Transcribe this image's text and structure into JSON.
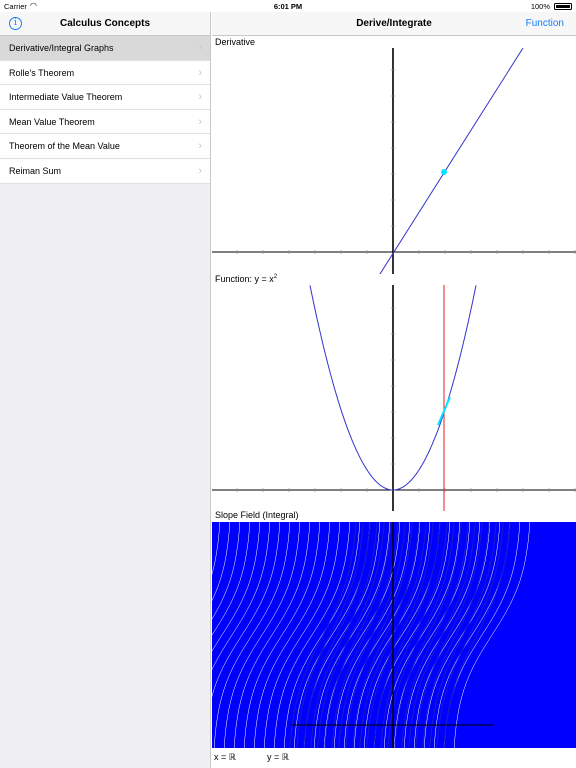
{
  "status": {
    "carrier": "Carrier",
    "time": "6:01 PM",
    "battery": "100%"
  },
  "master": {
    "title": "Calculus Concepts",
    "items": [
      {
        "label": "Derivative/Integral Graphs",
        "selected": true
      },
      {
        "label": "Rolle's Theorem"
      },
      {
        "label": "Intermediate Value Theorem"
      },
      {
        "label": "Mean Value Theorem"
      },
      {
        "label": "Theorem of the Mean Value"
      },
      {
        "label": "Reiman Sum"
      }
    ]
  },
  "detail": {
    "title": "Derive/Integrate",
    "right_button": "Function",
    "panels": {
      "derivative": {
        "label": "Derivative"
      },
      "function": {
        "label_prefix": "Function: y = x",
        "label_sup": "2"
      },
      "slope_field": {
        "label": "Slope Field (Integral)"
      }
    },
    "footer": {
      "x_domain": "x = ℝ",
      "y_domain": "y = ℝ"
    }
  },
  "colors": {
    "accent": "#147efb",
    "curve": "#3333cc",
    "marker": "#00e5ff",
    "tangent_line": "#e02020",
    "field": "#0000ff"
  }
}
